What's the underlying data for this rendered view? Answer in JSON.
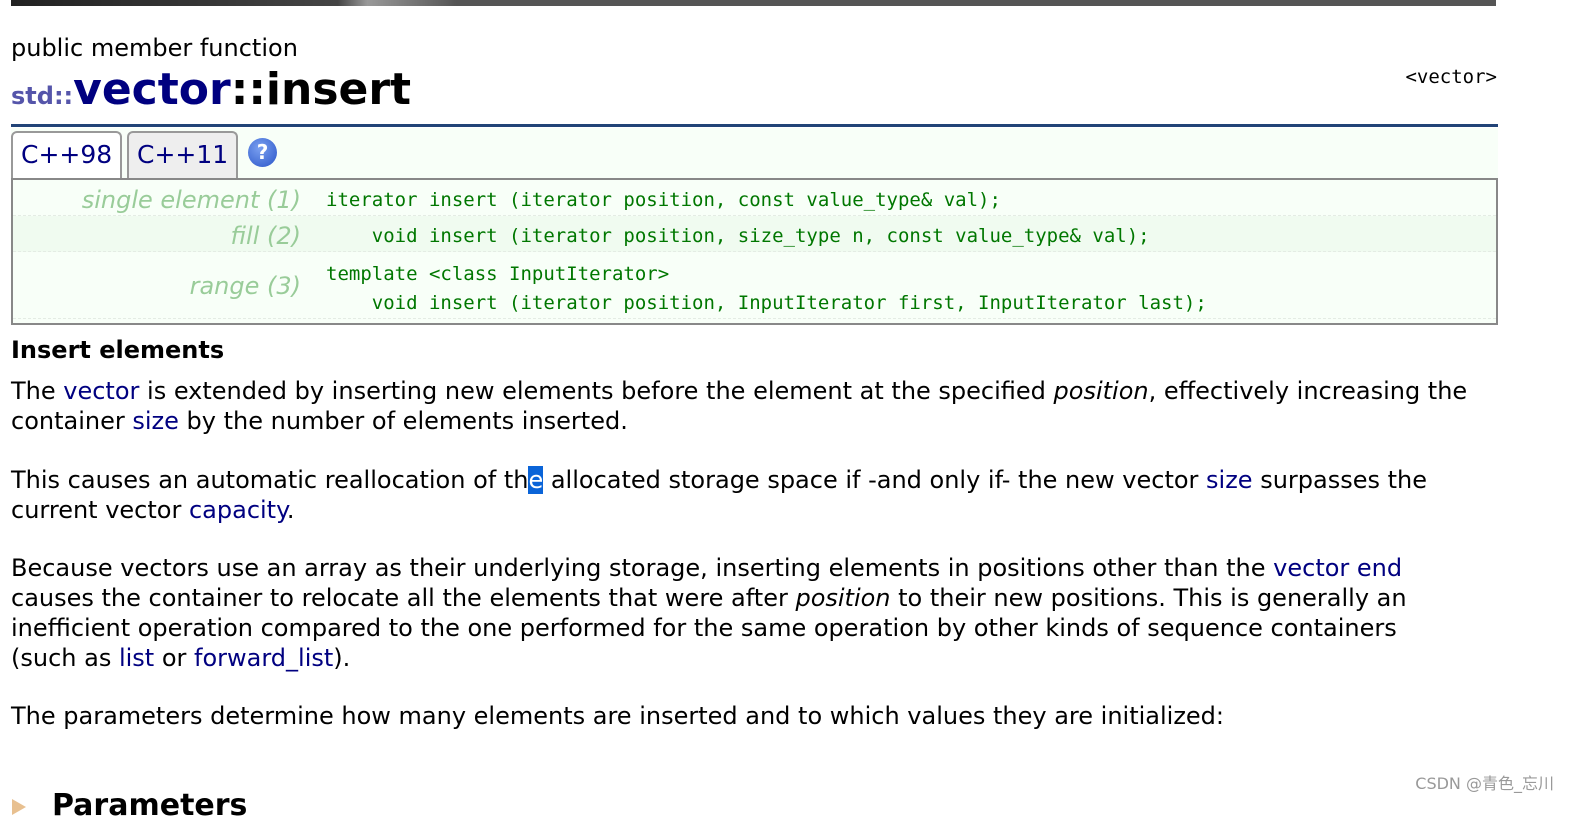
{
  "kind": "public member function",
  "title": {
    "ns": "std::",
    "cls": "vector",
    "sep": "::",
    "fn": "insert"
  },
  "header": "<vector>",
  "tabs": [
    {
      "label": "C++98",
      "active": true
    },
    {
      "label": "C++11",
      "active": false
    }
  ],
  "help_icon": "?",
  "declarations": [
    {
      "label": "single element (1)",
      "code": "iterator insert (iterator position, const value_type& val);"
    },
    {
      "label": "fill (2)",
      "code": "    void insert (iterator position, size_type n, const value_type& val);"
    },
    {
      "label": "range (3)",
      "code": "template <class InputIterator>\n    void insert (iterator position, InputIterator first, InputIterator last);"
    }
  ],
  "section_title": "Insert elements",
  "p1": {
    "a": "The ",
    "l1": "vector",
    "b": " is extended by inserting new elements before the element at the specified ",
    "i": "position",
    "c": ", effectively increasing the container ",
    "l2": "size",
    "d": " by the number of elements inserted."
  },
  "p2": {
    "a": "This causes an automatic reallocation of th",
    "sel": "e",
    "b": " allocated storage space if -and only if- the new vector ",
    "l1": "size",
    "c": " surpasses the current vector ",
    "l2": "capacity",
    "d": "."
  },
  "p3": {
    "a": "Because vectors use an array as their underlying storage, inserting elements in positions other than the ",
    "l1": "vector end",
    "b": " causes the container to relocate all the elements that were after ",
    "i": "position",
    "c": " to their new positions. This is generally an inefficient operation compared to the one performed for the same operation by other kinds of sequence containers (such as ",
    "l2": "list",
    "d": " or ",
    "l3": "forward_list",
    "e": ")."
  },
  "p4": "The parameters determine how many elements are inserted and to which values they are initialized:",
  "next_section": "Parameters",
  "watermark": "CSDN @青色_忘川"
}
